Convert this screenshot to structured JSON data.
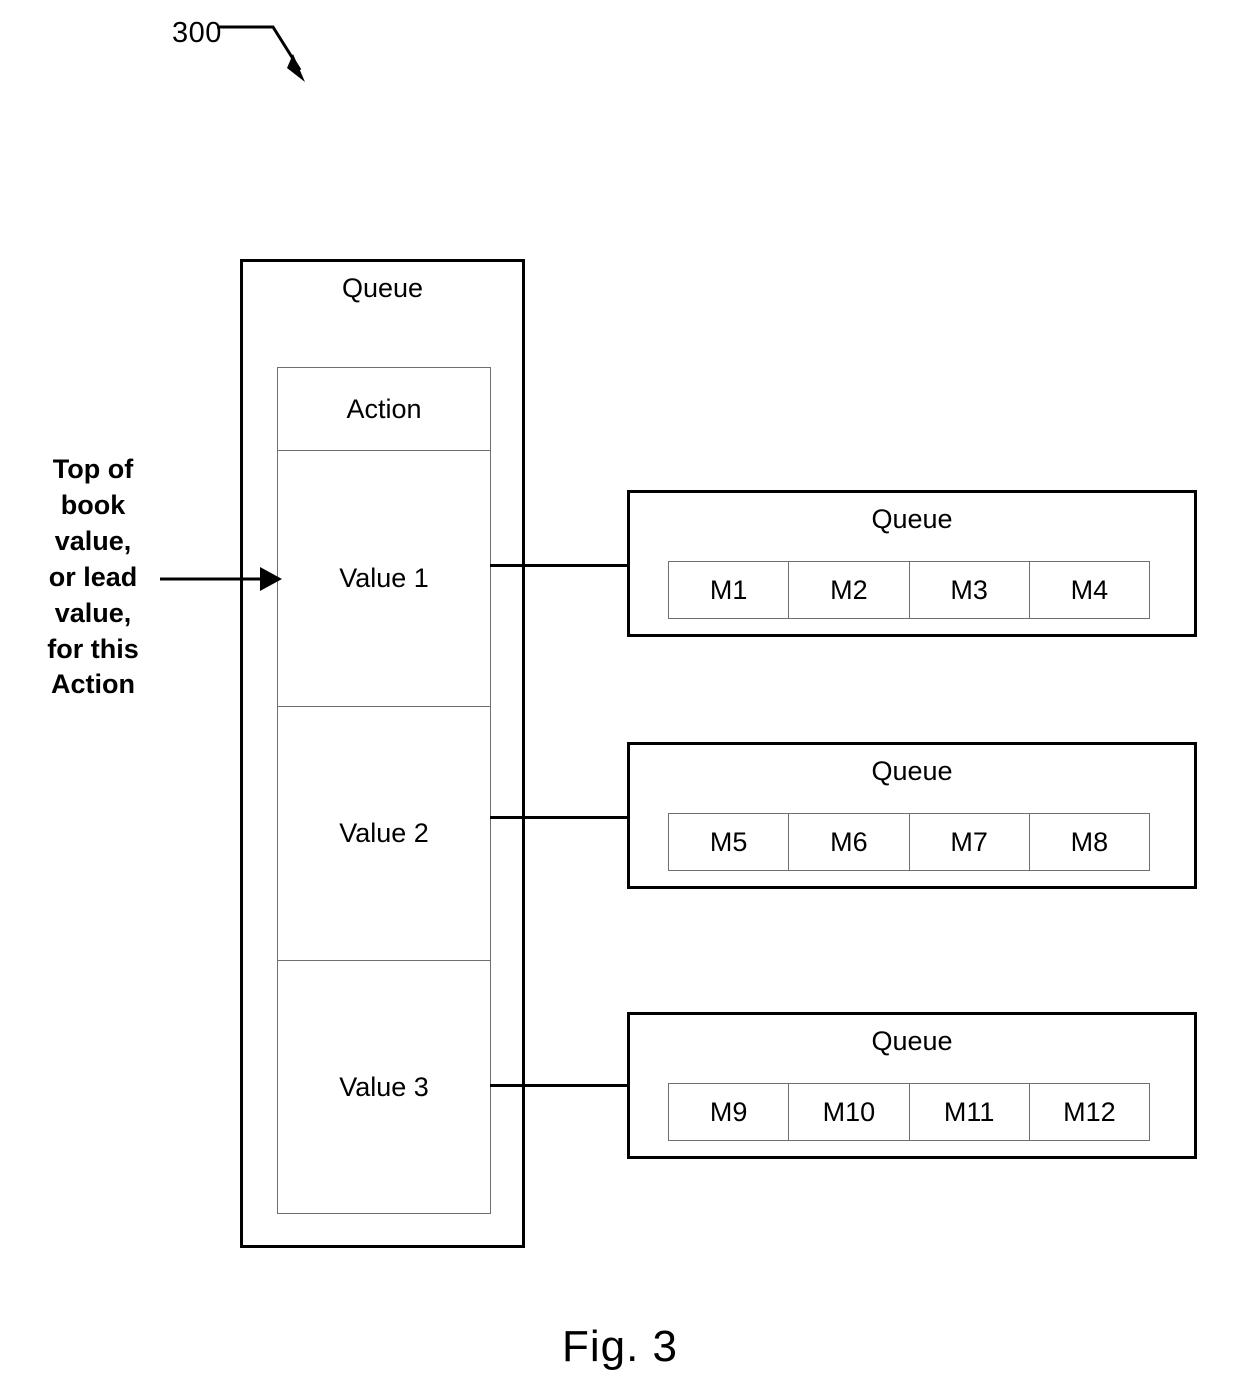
{
  "figure": {
    "reference_numeral": "300",
    "caption": "Fig. 3"
  },
  "left_queue": {
    "title": "Queue",
    "table": {
      "header": "Action",
      "rows": [
        {
          "label": "Value 1"
        },
        {
          "label": "Value 2"
        },
        {
          "label": "Value 3"
        }
      ]
    }
  },
  "annotation": {
    "text": "Top of book value, or lead value, for this Action",
    "lines": [
      "Top of",
      "book",
      "value,",
      "or lead",
      "value,",
      "for this",
      "Action"
    ]
  },
  "message_queues": [
    {
      "title": "Queue",
      "messages": [
        "M1",
        "M2",
        "M3",
        "M4"
      ]
    },
    {
      "title": "Queue",
      "messages": [
        "M5",
        "M6",
        "M7",
        "M8"
      ]
    },
    {
      "title": "Queue",
      "messages": [
        "M9",
        "M10",
        "M11",
        "M12"
      ]
    }
  ],
  "colors": {
    "line": "#000000",
    "thin_line": "#6f6f6f",
    "background": "#ffffff"
  }
}
